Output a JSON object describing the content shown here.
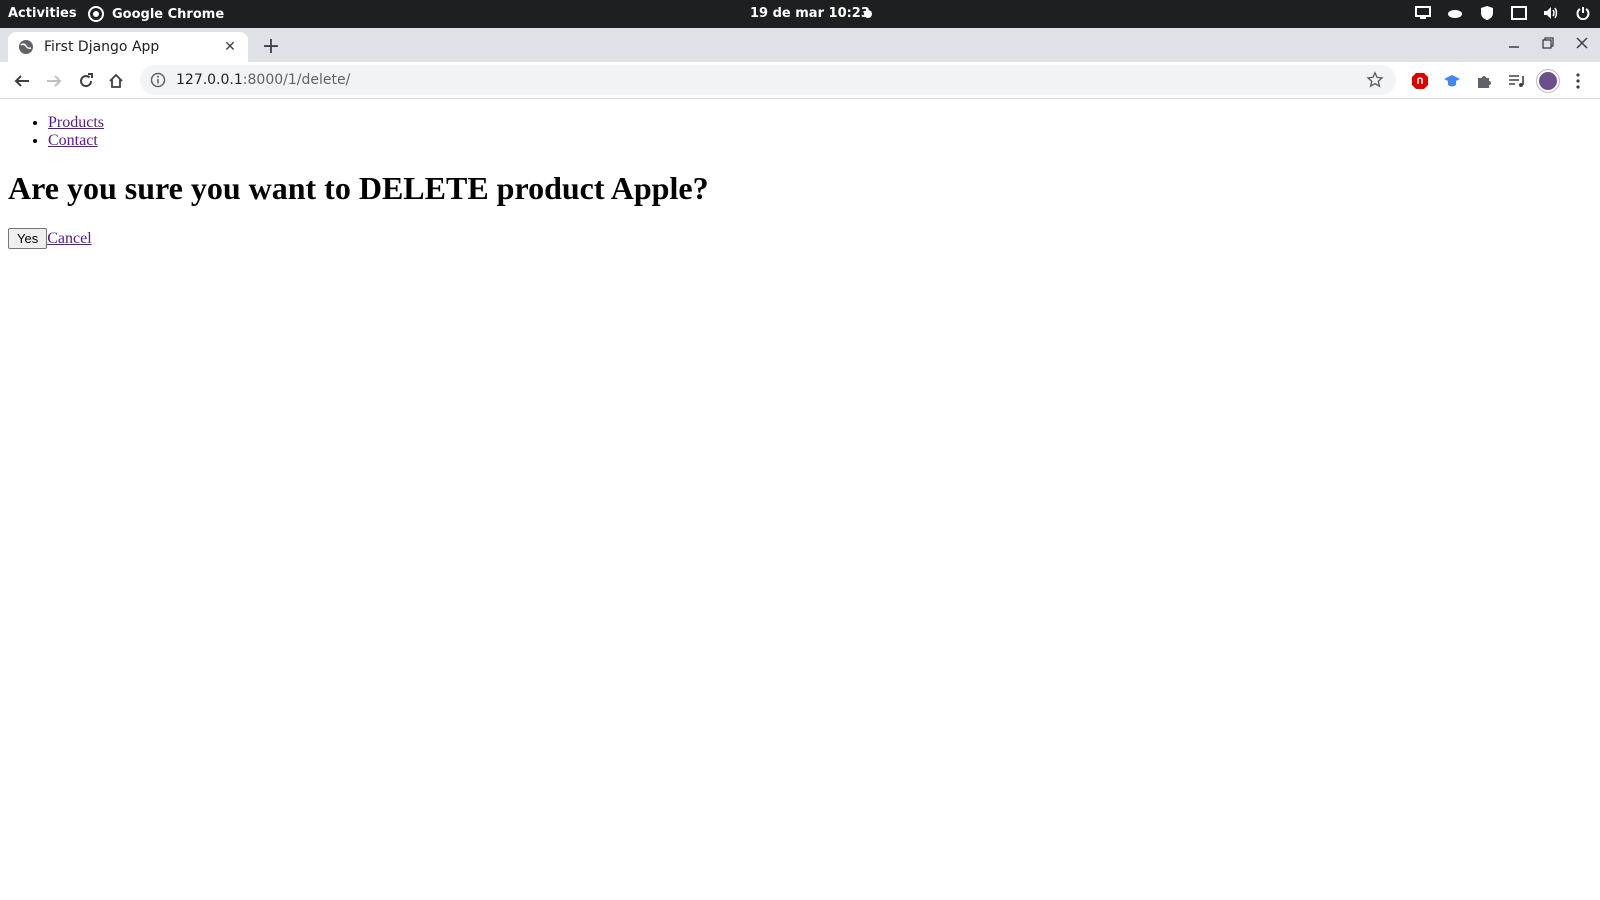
{
  "system_bar": {
    "activities": "Activities",
    "app_name": "Google Chrome",
    "clock": "19 de mar  10:23"
  },
  "browser": {
    "tab_title": "First Django App",
    "url_host": "127.0.0.1",
    "url_path": ":8000/1/delete/"
  },
  "page": {
    "nav": [
      {
        "label": "Products"
      },
      {
        "label": "Contact"
      }
    ],
    "heading": "Are you sure you want to DELETE product Apple?",
    "yes_label": "Yes",
    "cancel_label": "Cancel"
  },
  "colors": {
    "link_visited": "#551a8b",
    "topbar_bg": "#1d1f21",
    "tabstrip_bg": "#dee1e6"
  }
}
